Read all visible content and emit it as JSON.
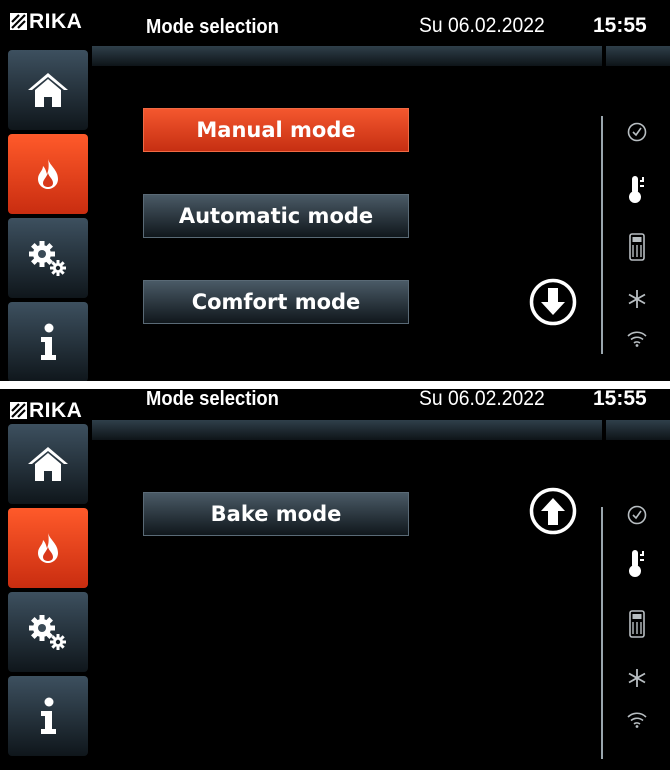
{
  "brand": {
    "logo_text": "RIKA"
  },
  "header": {
    "title": "Mode selection",
    "date": "Su 06.02.2022",
    "time": "15:55"
  },
  "sidebar": {
    "items": [
      {
        "icon": "home-icon",
        "active": false
      },
      {
        "icon": "flame-icon",
        "active": true
      },
      {
        "icon": "settings-gears-icon",
        "active": false
      },
      {
        "icon": "info-icon",
        "active": false
      }
    ]
  },
  "screen1": {
    "modes": [
      {
        "label": "Manual mode",
        "selected": true
      },
      {
        "label": "Automatic mode",
        "selected": false
      },
      {
        "label": "Comfort mode",
        "selected": false
      }
    ],
    "scroll": "down"
  },
  "screen2": {
    "modes": [
      {
        "label": "Bake mode",
        "selected": false
      }
    ],
    "scroll": "up"
  },
  "status_icons": [
    "clock-icon",
    "thermometer-icon",
    "room-sensor-icon",
    "frost-icon",
    "wifi-icon"
  ],
  "colors": {
    "accent": "#e8461e",
    "panel": "#2f3f4a",
    "background": "#000000"
  }
}
